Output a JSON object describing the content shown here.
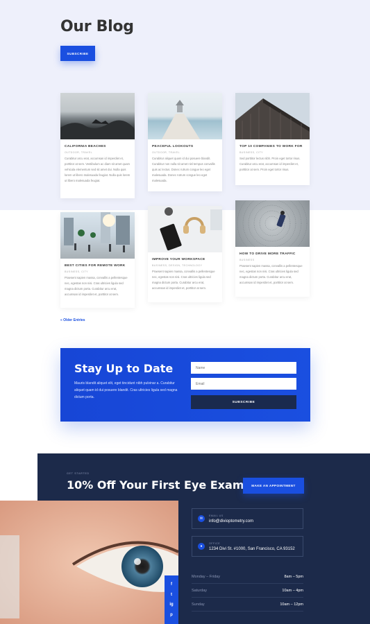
{
  "blog": {
    "title": "Our Blog",
    "subscribe_label": "SUBSCRIBE",
    "older_entries": "« Older Entries"
  },
  "posts": [
    {
      "title": "CALIFORNIA BEACHES",
      "category": "OUTDOOR, TRAVEL",
      "excerpt": "Curabitur arcu erat, accumsan id imperdiet et, porttitor at sem. Vestibulum ac diam sit amet quam vehicula elementum sed sit amet dui. Nulla quis lorem ut libero malesuada feugiat. Nulla quis lorem ut libero malesuada feugiat."
    },
    {
      "title": "PEACEFUL LOOKOUTS",
      "category": "OUTDOOR, TRAVEL",
      "excerpt": "Curabitur aliquet quam id dui posuere blandit. Curabitur non nulla sit amet nisl tempus convallis quis ac lectus. Donec rutrum congue leo eget malesuada. Donec rutrum congue leo eget malesuada."
    },
    {
      "title": "TOP 10 COMPANIES TO WORK FOR",
      "category": "BUSINESS, CITY",
      "excerpt": "Sed porttitor lectus nibh. Proin eget tortor risus. Curabitur arcu erat, accumsan id imperdiet et, porttitor at sem. Proin eget tortor risus."
    },
    {
      "title": "BEST CITIES FOR REMOTE WORK",
      "category": "BUSINESS, CITY",
      "excerpt": "Praesent sapien massa, convallis a pellentesque nec, egestas non nisi. Cras ultricies ligula sed magna dictum porta. Curabitur arcu erat, accumsan id imperdiet et, porttitor at sem."
    },
    {
      "title": "IMPROVE YOUR WORKSPACE",
      "category": "BUSINESS, DESIGN, TECHNOLOGY",
      "excerpt": "Praesent sapien massa, convallis a pellentesque nec, egestas non nisi. Cras ultricies ligula sed magna dictum porta. Curabitur arcu erat, accumsan id imperdiet et, porttitor at sem."
    },
    {
      "title": "HOW TO DRIVE MORE TRAFFIC",
      "category": "BUSINESS",
      "excerpt": "Praesent sapien massa, convallis a pellentesque nec, egestas non nisi. Cras ultricies ligula sed magna dictum porta. Curabitur arcu erat, accumsan id imperdiet et, porttitor at sem."
    }
  ],
  "newsletter": {
    "heading": "Stay Up to Date",
    "text": "Mauris blandit aliquet elit, eget tincidunt nibh pulvinar a. Curabitur aliquet quam id dui posuere blandit. Cras ultricies ligula sed magna dictum porta.",
    "name_placeholder": "Name",
    "email_placeholder": "Email",
    "button": "SUBSCRIBE"
  },
  "offer": {
    "eyebrow": "GET STARTED",
    "heading": "10% Off Your First Eye Exam",
    "button": "MAKE AN APPOINTMENT"
  },
  "contact": {
    "email_label": "EMAIL US",
    "email": "info@divioptometry.com",
    "office_label": "OFFICE",
    "office": "1234 Divi St. #1000, San Francisco, CA 93152"
  },
  "hours": [
    {
      "day": "Monday – Friday",
      "time": "8am – 5pm"
    },
    {
      "day": "Saturday",
      "time": "10am – 4pm"
    },
    {
      "day": "Sunday",
      "time": "10am – 12pm"
    }
  ],
  "social": [
    "f",
    "t",
    "ig",
    "p"
  ],
  "colors": {
    "accent": "#1a4fe0",
    "dark": "#1c2a4a",
    "bg_light": "#eef0fb"
  }
}
